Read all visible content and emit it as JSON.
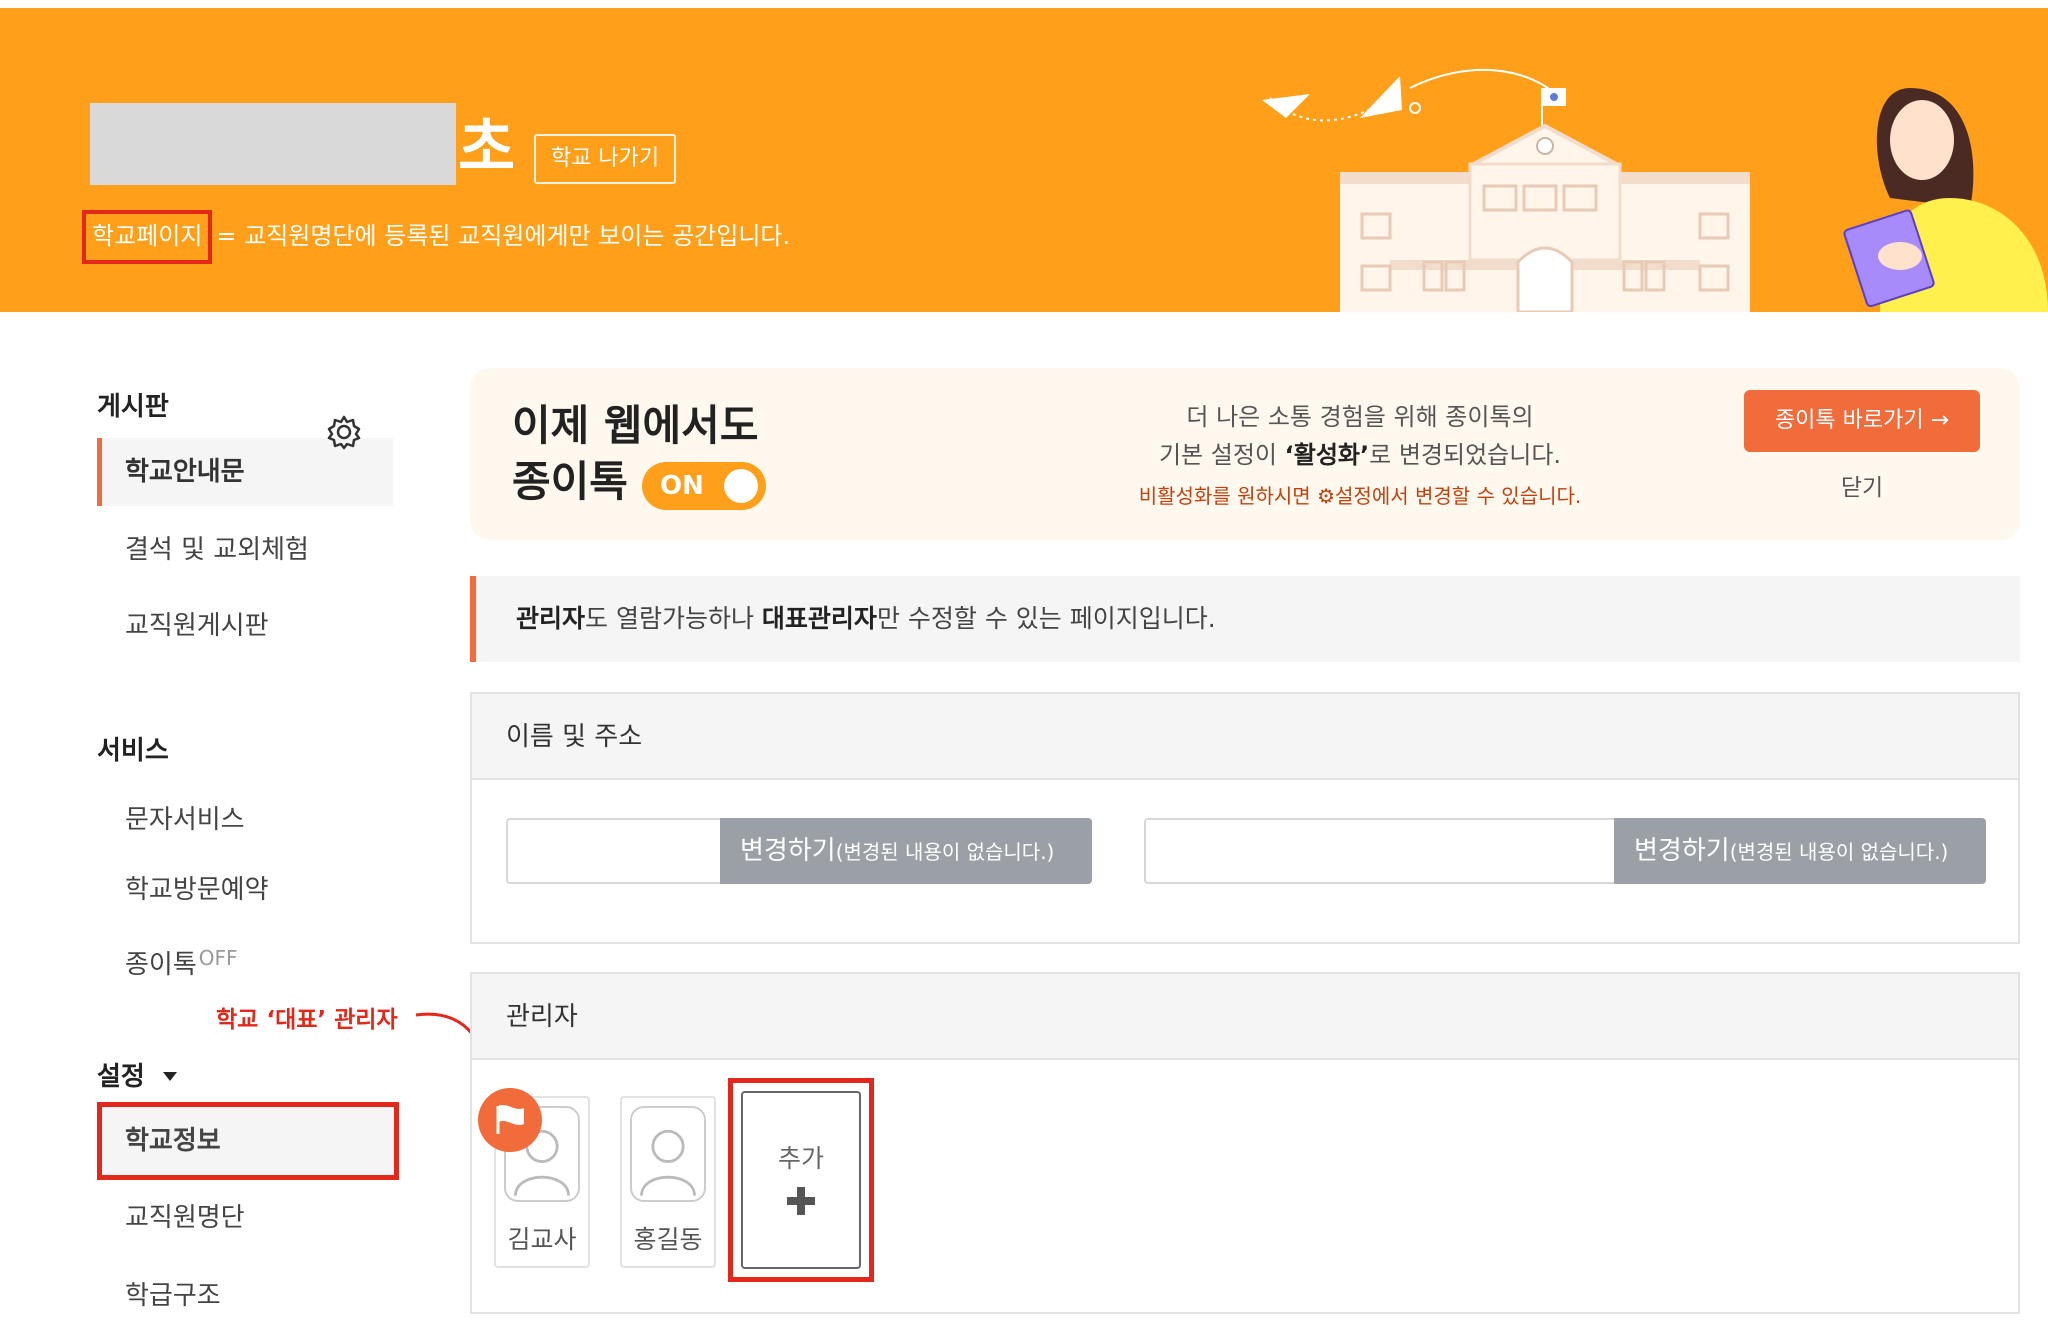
{
  "banner": {
    "school_suffix": "초",
    "leave_button": "학교 나가기",
    "desc_highlight": "학교페이지",
    "desc_rest": "= 교직원명단에 등록된 교직원에게만 보이는 공간입니다."
  },
  "sidebar": {
    "board_heading": "게시판",
    "board_items": [
      "학교안내문",
      "결석 및 교외체험",
      "교직원게시판"
    ],
    "service_heading": "서비스",
    "service_items": [
      "문자서비스",
      "학교방문예약",
      "종이톡"
    ],
    "off_badge": "OFF",
    "settings_heading": "설정",
    "settings_items": [
      "학교정보",
      "교직원명단",
      "학급구조"
    ],
    "annotation": "학교 ‘대표’ 관리자"
  },
  "promo": {
    "title_line1": "이제 웹에서도",
    "title_line2": "종이톡",
    "toggle": "ON",
    "text_line1": "더 나은 소통 경험을 위해 종이톡의",
    "text_line2_pre": "기본 설정이 ",
    "text_line2_bold": "‘활성화’",
    "text_line2_post": "로 변경되었습니다.",
    "warn_pre": "비활성화를 원하시면 ",
    "warn_post": "설정에서 변경할 수 있습니다.",
    "go_button": "종이톡 바로가기 →",
    "close": "닫기"
  },
  "notice": {
    "bold1": "관리자",
    "text1": "도 열람가능하나 ",
    "bold2": "대표관리자",
    "text2": "만 수정할 수 있는 페이지입니다."
  },
  "name_address": {
    "heading": "이름 및 주소",
    "change_label": "변경하기",
    "change_note": "(변경된 내용이 없습니다.)"
  },
  "admins": {
    "heading": "관리자",
    "people": [
      "김교사",
      "홍길동"
    ],
    "add_label": "추가"
  },
  "colors": {
    "banner": "#ff9f1a",
    "accent": "#f26b3a",
    "highlight_box": "#e4271b"
  }
}
